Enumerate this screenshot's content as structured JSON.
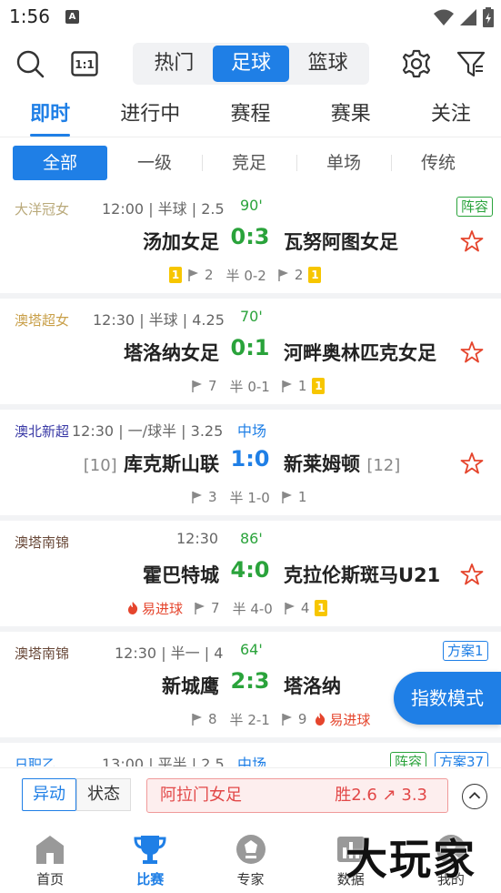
{
  "status_bar": {
    "time": "1:56",
    "notif_icon": "A"
  },
  "top_bar": {
    "segments": [
      "热门",
      "足球",
      "篮球"
    ],
    "active_segment": 1
  },
  "main_tabs": [
    "即时",
    "进行中",
    "赛程",
    "赛果",
    "关注"
  ],
  "sub_filters": [
    "全部",
    "一级",
    "竞足",
    "单场",
    "传统"
  ],
  "matches": [
    {
      "league": "大洋冠女",
      "league_color": "#b9a97a",
      "time": "12:00",
      "handicap": "半球",
      "total": "2.5",
      "status": "90'",
      "status_color": "#2aa33b",
      "home": "汤加女足",
      "home_rank": "",
      "score": "0:3",
      "score_color": "#2aa33b",
      "away": "瓦努阿图女足",
      "away_rank": "",
      "tags": [
        "阵容"
      ],
      "home_yellow": "1",
      "home_corners": "2",
      "half": "半 0-2",
      "away_corners": "2",
      "away_yellow": "1"
    },
    {
      "league": "澳塔超女",
      "league_color": "#c9a04a",
      "time": "12:30",
      "handicap": "半球",
      "total": "4.25",
      "status": "70'",
      "status_color": "#2aa33b",
      "home": "塔洛纳女足",
      "home_rank": "",
      "score": "0:1",
      "score_color": "#2aa33b",
      "away": "河畔奥林匹克女足",
      "away_rank": "",
      "tags": [],
      "home_yellow": "",
      "home_corners": "7",
      "half": "半 0-1",
      "away_corners": "1",
      "away_yellow": "1"
    },
    {
      "league": "澳北新超",
      "league_color": "#3a3aa6",
      "time": "12:30",
      "handicap": "一/球半",
      "total": "3.25",
      "status": "中场",
      "status_color": "#1f7fe6",
      "home": "库克斯山联",
      "home_rank": "[10]",
      "score": "1:0",
      "score_color": "#1f7fe6",
      "away": "新莱姆顿",
      "away_rank": "[12]",
      "tags": [],
      "home_yellow": "",
      "home_corners": "3",
      "half": "半 1-0",
      "away_corners": "1",
      "away_yellow": ""
    },
    {
      "league": "澳塔南锦",
      "league_color": "#6a4a3a",
      "time": "12:30",
      "handicap": "",
      "total": "",
      "status": "86'",
      "status_color": "#2aa33b",
      "home": "霍巴特城",
      "home_rank": "",
      "score": "4:0",
      "score_color": "#2aa33b",
      "away": "克拉伦斯斑马U21",
      "away_rank": "",
      "tags": [],
      "hot_home": "易进球",
      "home_yellow": "",
      "home_corners": "7",
      "half": "半 4-0",
      "away_corners": "4",
      "away_yellow": "1"
    },
    {
      "league": "澳塔南锦",
      "league_color": "#6a4a3a",
      "time": "12:30",
      "handicap": "半一",
      "total": "4",
      "status": "64'",
      "status_color": "#2aa33b",
      "home": "新城鹰",
      "home_rank": "",
      "score": "2:3",
      "score_color": "#2aa33b",
      "away": "塔洛纳",
      "away_rank": "",
      "tags": [
        "方案1"
      ],
      "hot_away": "易进球",
      "home_yellow": "",
      "home_corners": "8",
      "half": "半 2-1",
      "away_corners": "9",
      "away_yellow": ""
    },
    {
      "league": "日职乙",
      "league_color": "#1f7fe6",
      "time": "13:00",
      "handicap": "平半",
      "total": "2.5",
      "status": "中场",
      "status_color": "#1f7fe6",
      "home": "",
      "home_rank": "",
      "score": "",
      "score_color": "#1f7fe6",
      "away": "",
      "away_rank": "",
      "tags": [
        "阵容",
        "方案37"
      ]
    }
  ],
  "fab_label": "指数模式",
  "alert_bar": {
    "btn_change": "异动",
    "btn_status": "状态",
    "team": "阿拉门女足",
    "odds": "胜2.6 ↗ 3.3"
  },
  "bottom_nav": [
    "首页",
    "比赛",
    "专家",
    "数据",
    "我的"
  ],
  "watermark": "大玩家",
  "colors": {
    "accent": "#1f7fe6",
    "live_green": "#2aa33b",
    "hot_red": "#e5452d",
    "yellow_card": "#f7c600"
  }
}
